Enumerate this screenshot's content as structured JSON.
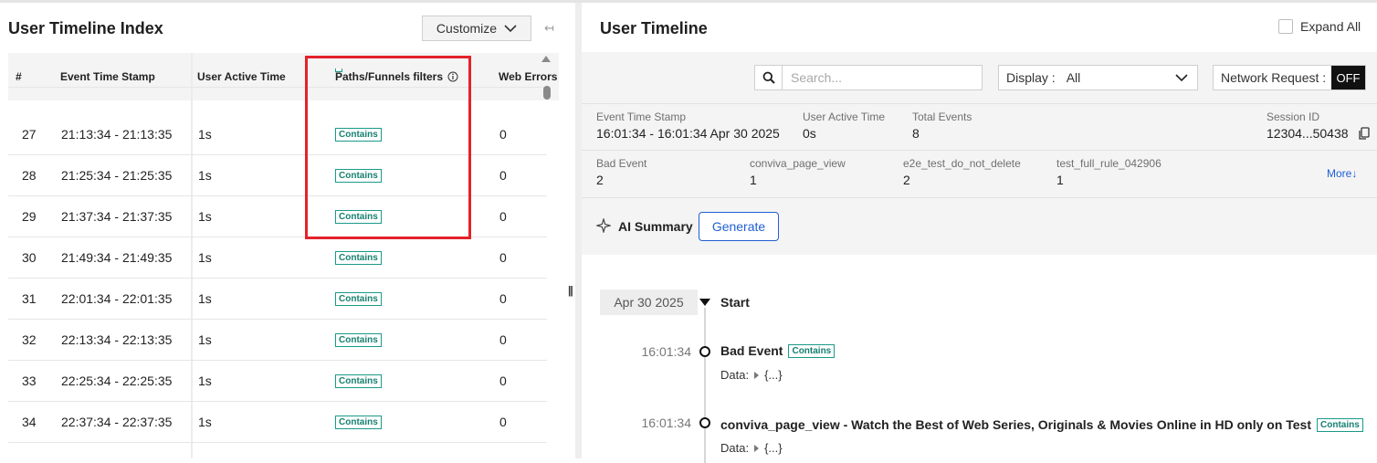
{
  "left_panel": {
    "title": "User Timeline Index",
    "customize_label": "Customize",
    "columns": [
      "#",
      "Event Time Stamp",
      "User Active Time",
      "Paths/Funnels filters",
      "Web Errors"
    ],
    "rows": [
      {
        "num": "27",
        "time": "21:13:34 - 21:13:35",
        "active": "1s",
        "filter": "Contains",
        "errors": "0"
      },
      {
        "num": "28",
        "time": "21:25:34 - 21:25:35",
        "active": "1s",
        "filter": "Contains",
        "errors": "0"
      },
      {
        "num": "29",
        "time": "21:37:34 - 21:37:35",
        "active": "1s",
        "filter": "Contains",
        "errors": "0"
      },
      {
        "num": "30",
        "time": "21:49:34 - 21:49:35",
        "active": "1s",
        "filter": "Contains",
        "errors": "0"
      },
      {
        "num": "31",
        "time": "22:01:34 - 22:01:35",
        "active": "1s",
        "filter": "Contains",
        "errors": "0"
      },
      {
        "num": "32",
        "time": "22:13:34 - 22:13:35",
        "active": "1s",
        "filter": "Contains",
        "errors": "0"
      },
      {
        "num": "33",
        "time": "22:25:34 - 22:25:35",
        "active": "1s",
        "filter": "Contains",
        "errors": "0"
      },
      {
        "num": "34",
        "time": "22:37:34 - 22:37:35",
        "active": "1s",
        "filter": "Contains",
        "errors": "0"
      }
    ],
    "highlight_color": "#e3222b"
  },
  "right_panel": {
    "title": "User Timeline",
    "expand_all_label": "Expand All",
    "search_placeholder": "Search...",
    "display_label": "Display :",
    "display_value": "All",
    "network_request_label": "Network Request :",
    "network_request_state": "OFF",
    "meta_row1": [
      {
        "label": "Event Time Stamp",
        "value": "16:01:34 - 16:01:34 Apr 30 2025"
      },
      {
        "label": "User Active Time",
        "value": "0s"
      },
      {
        "label": "Total Events",
        "value": "8"
      },
      {
        "label": "Session ID",
        "value": "12304...50438"
      }
    ],
    "meta_row2": [
      {
        "label": "Bad Event",
        "value": "2"
      },
      {
        "label": "conviva_page_view",
        "value": "1"
      },
      {
        "label": "e2e_test_do_not_delete",
        "value": "2"
      },
      {
        "label": "test_full_rule_042906",
        "value": "1"
      }
    ],
    "more_label": "More↓",
    "ai_summary_label": "AI Summary",
    "generate_label": "Generate",
    "timeline": {
      "date": "Apr 30 2025",
      "start_label": "Start",
      "data_label": "Data:",
      "data_value": "{...}",
      "events": [
        {
          "time": "16:01:34",
          "title": "Bad Event",
          "tag": "Contains"
        },
        {
          "time": "16:01:34",
          "title": "conviva_page_view - Watch the Best of Web Series, Originals & Movies Online in HD only on Test",
          "tag": "Contains"
        }
      ]
    },
    "accent_color": "#1f5fd6",
    "tag_color": "#15806f"
  }
}
